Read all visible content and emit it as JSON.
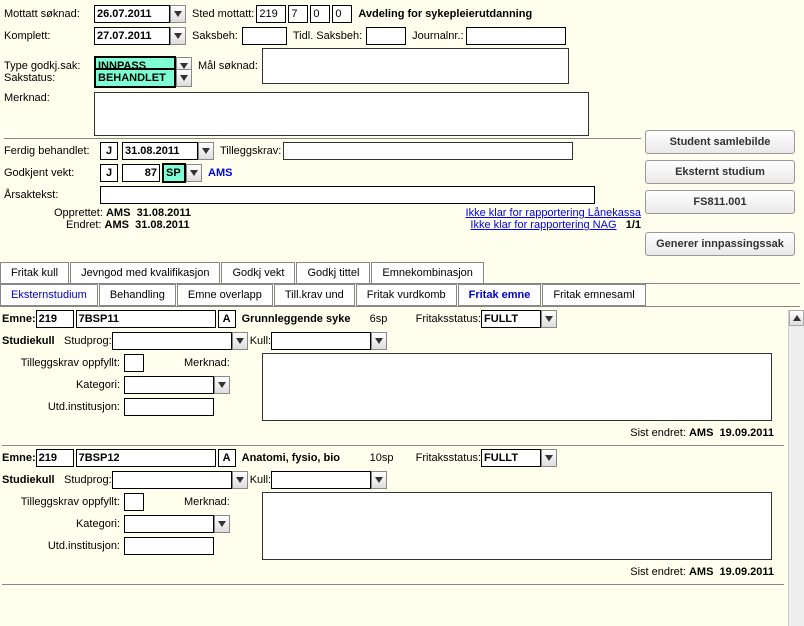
{
  "header": {
    "mottatt_soknad_label": "Mottatt søknad:",
    "mottatt_soknad_date": "26.07.2011",
    "sted_mottatt_label": "Sted mottatt:",
    "sted_codes": [
      "219",
      "7",
      "0",
      "0"
    ],
    "avdeling": "Avdeling for sykepleierutdanning",
    "komplett_label": "Komplett:",
    "komplett_date": "27.07.2011",
    "saksbeh_label": "Saksbeh:",
    "tidl_saksbeh_label": "Tidl. Saksbeh:",
    "journalnr_label": "Journalnr.:",
    "type_godkj_label": "Type godkj.sak:",
    "type_godkj_value": "INNPASS",
    "mal_soknad_label": "Mål søknad:",
    "sakstatus_label": "Sakstatus:",
    "sakstatus_value": "BEHANDLET",
    "merknad_label": "Merknad:",
    "ferdig_behandlet_label": "Ferdig behandlet:",
    "ferdig_behandlet_j": "J",
    "ferdig_behandlet_date": "31.08.2011",
    "tilleggskrav_label": "Tilleggskrav:",
    "godkjent_vekt_label": "Godkjent vekt:",
    "godkjent_vekt_j": "J",
    "godkjent_vekt_val": "87",
    "godkjent_vekt_unit": "SP",
    "ams_link": "AMS",
    "arsaktekst_label": "Årsaktekst:",
    "opprettet_label": "Opprettet:",
    "opprettet_by": "AMS",
    "opprettet_date": "31.08.2011",
    "endret_label": "Endret:",
    "endret_by": "AMS",
    "endret_date": "31.08.2011",
    "link_lanekassa": "Ikke klar for rapportering Lånekassa",
    "link_nag": "Ikke klar for rapportering NAG",
    "page_indicator": "1/1"
  },
  "side": {
    "btn1": "Student samlebilde",
    "btn2": "Eksternt studium",
    "btn3": "FS811.001",
    "btn4": "Generer innpassingssak"
  },
  "tabs_top": [
    "Fritak kull",
    "Jevngod med kvalifikasjon",
    "Godkj vekt",
    "Godkj tittel",
    "Emnekombinasjon"
  ],
  "tabs_bottom": [
    "Eksternstudium",
    "Behandling",
    "Emne overlapp",
    "Till.krav und",
    "Fritak vurdkomb",
    "Fritak emne",
    "Fritak emnesaml"
  ],
  "active_tab": "Fritak emne",
  "emne_labels": {
    "emne": "Emne:",
    "fritaksstatus": "Fritaksstatus:",
    "studiekull": "Studiekull",
    "studprog": "Studprog:",
    "kull": "Kull:",
    "tilleggskrav_oppfyllt": "Tilleggskrav oppfyllt:",
    "merknad": "Merknad:",
    "kategori": "Kategori:",
    "utd_institusjon": "Utd.institusjon:",
    "sist_endret": "Sist endret:"
  },
  "emne1": {
    "code1": "219",
    "code2": "7BSP11",
    "grade": "A",
    "name": "Grunnleggende syke",
    "sp": "6sp",
    "fritaksstatus": "FULLT",
    "sist_by": "AMS",
    "sist_date": "19.09.2011"
  },
  "emne2": {
    "code1": "219",
    "code2": "7BSP12",
    "grade": "A",
    "name": "Anatomi, fysio, bio",
    "sp": "10sp",
    "fritaksstatus": "FULLT",
    "sist_by": "AMS",
    "sist_date": "19.09.2011"
  }
}
